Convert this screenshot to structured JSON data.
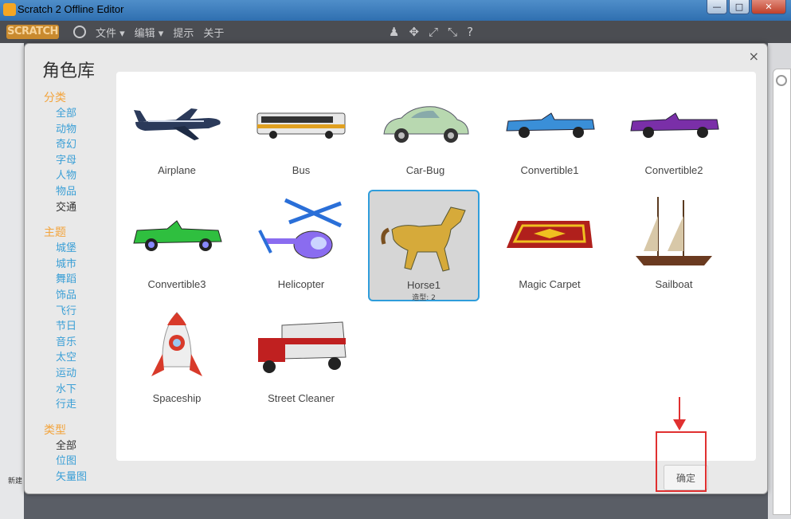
{
  "window": {
    "title": "Scratch 2 Offline Editor",
    "buttons": [
      "—",
      "□",
      "✕"
    ]
  },
  "menubar": {
    "logo": "SCRATCH",
    "items": [
      "文件 ▾",
      "编辑 ▾",
      "提示",
      "关于"
    ],
    "tools": [
      "♟",
      "✥",
      "⤢",
      "⤡",
      "?"
    ]
  },
  "dialog": {
    "title": "角色库",
    "close_label": "×",
    "sections": [
      {
        "heading": "分类",
        "items": [
          {
            "label": "全部",
            "active": false
          },
          {
            "label": "动物",
            "active": false
          },
          {
            "label": "奇幻",
            "active": false
          },
          {
            "label": "字母",
            "active": false
          },
          {
            "label": "人物",
            "active": false
          },
          {
            "label": "物品",
            "active": false
          },
          {
            "label": "交通",
            "active": true
          }
        ]
      },
      {
        "heading": "主题",
        "items": [
          {
            "label": "城堡"
          },
          {
            "label": "城市"
          },
          {
            "label": "舞蹈"
          },
          {
            "label": "饰品"
          },
          {
            "label": "飞行"
          },
          {
            "label": "节日"
          },
          {
            "label": "音乐"
          },
          {
            "label": "太空"
          },
          {
            "label": "运动"
          },
          {
            "label": "水下"
          },
          {
            "label": "行走"
          }
        ]
      },
      {
        "heading": "类型",
        "items": [
          {
            "label": "全部",
            "active": true
          },
          {
            "label": "位图"
          },
          {
            "label": "矢量图"
          }
        ]
      }
    ],
    "sprites": [
      {
        "name": "Airplane",
        "icon": "airplane-icon"
      },
      {
        "name": "Bus",
        "icon": "bus-icon"
      },
      {
        "name": "Car-Bug",
        "icon": "car-icon"
      },
      {
        "name": "Convertible1",
        "icon": "convertible-icon"
      },
      {
        "name": "Convertible2",
        "icon": "convertible-icon"
      },
      {
        "name": "Convertible3",
        "icon": "convertible-icon"
      },
      {
        "name": "Helicopter",
        "icon": "helicopter-icon"
      },
      {
        "name": "Horse1",
        "icon": "horse-icon",
        "selected": true,
        "costumes": "造型: 2"
      },
      {
        "name": "Magic Carpet",
        "icon": "carpet-icon"
      },
      {
        "name": "Sailboat",
        "icon": "sailboat-icon"
      },
      {
        "name": "Spaceship",
        "icon": "rocket-icon"
      },
      {
        "name": "Street Cleaner",
        "icon": "street-cleaner-icon"
      }
    ],
    "ok_label": "确定"
  },
  "background": {
    "new_sprite_label": "新建"
  },
  "colors": {
    "accent_blue": "#2f9ddb",
    "category_orange": "#f3a43c",
    "link_blue": "#3a9fd6",
    "annotation_red": "#e03030"
  }
}
